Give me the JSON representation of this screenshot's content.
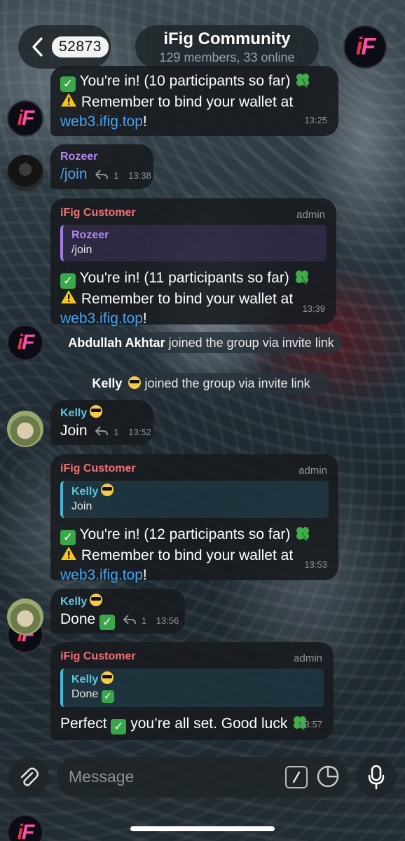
{
  "header": {
    "unread_count": "52873",
    "title": "iFig Community",
    "subtitle": "129 members, 33 online",
    "logo_text": "iF"
  },
  "messages": [
    {
      "line1": "You're in! (10 participants so far)",
      "line2": "Remember to bind your wallet at",
      "link": "web3.ifig.top",
      "link_suffix": "!",
      "time": "13:25"
    },
    {
      "sender": "Rozeer",
      "text": "/join",
      "replies": "1",
      "time": "13:38"
    },
    {
      "sender": "iFig Customer",
      "role": "admin",
      "quote_name": "Rozeer",
      "quote_text": "/join",
      "line1": "You're in! (11 participants so far)",
      "line2": "Remember to bind your wallet at",
      "link": "web3.ifig.top",
      "link_suffix": "!",
      "time": "13:39"
    },
    {
      "sys_name": "Abdullah Akhtar",
      "sys_text": "joined the group via invite link"
    },
    {
      "sys_name": "Kelly",
      "sys_text": "joined the group via invite link"
    },
    {
      "sender": "Kelly",
      "text": "Join",
      "replies": "1",
      "time": "13:52"
    },
    {
      "sender": "iFig Customer",
      "role": "admin",
      "quote_name": "Kelly",
      "quote_text": "Join",
      "line1": "You're in! (12 participants so far)",
      "line2": "Remember to bind your wallet at",
      "link": "web3.ifig.top",
      "link_suffix": "!",
      "time": "13:53"
    },
    {
      "sender": "Kelly",
      "text": "Done",
      "replies": "1",
      "time": "13:56"
    },
    {
      "sender": "iFig Customer",
      "role": "admin",
      "quote_name": "Kelly",
      "quote_text": "Done",
      "text_a": "Perfect",
      "text_b": "you’re all set. Good luck",
      "time": "13:57"
    }
  ],
  "composer": {
    "placeholder": "Message"
  },
  "icons": {
    "back": "chevron-left-icon",
    "attach": "paperclip-icon",
    "command": "slash-command-icon",
    "sticker": "sticker-icon",
    "mic": "microphone-icon",
    "check": "check-mark-emoji",
    "warning": "warning-emoji",
    "clover": "four-leaf-clover-emoji",
    "sunglasses": "sunglasses-emoji",
    "reply": "reply-arrow-icon"
  },
  "colors": {
    "link": "#4aa3f0",
    "admin_name": "#f07178",
    "rozeer_name": "#b188f0",
    "kelly_name": "#5fc6dd"
  }
}
